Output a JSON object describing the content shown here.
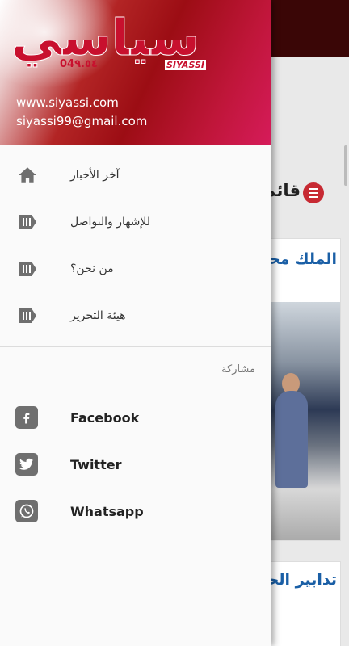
{
  "background": {
    "section_title": "قائمة",
    "card1_headline": "الملك محمد رئيس",
    "card2_headline": "تدابير الحديدية"
  },
  "drawer": {
    "header": {
      "logo_text": "سياسي",
      "logo_digits": "04٩.٥٤",
      "logo_latin": "SIYASSI",
      "url": "www.siyassi.com",
      "email": "siyassi99@gmail.com"
    },
    "nav_items": [
      {
        "label": "آخر الأخبار",
        "icon": "home-icon"
      },
      {
        "label": "للإشهار والتواصل",
        "icon": "label-tag-icon"
      },
      {
        "label": "من نحن؟",
        "icon": "label-tag-icon"
      },
      {
        "label": "هيئة التحرير",
        "icon": "label-tag-icon"
      }
    ],
    "share_title": "مشاركة",
    "social_items": [
      {
        "label": "Facebook",
        "icon": "facebook-icon"
      },
      {
        "label": "Twitter",
        "icon": "twitter-icon"
      },
      {
        "label": "Whatsapp",
        "icon": "whatsapp-icon"
      }
    ]
  },
  "colors": {
    "brand_red": "#c8102e",
    "header_pink": "#d61b5a",
    "icon_gray": "#6f6f6f",
    "link_blue": "#1a5fa6"
  }
}
